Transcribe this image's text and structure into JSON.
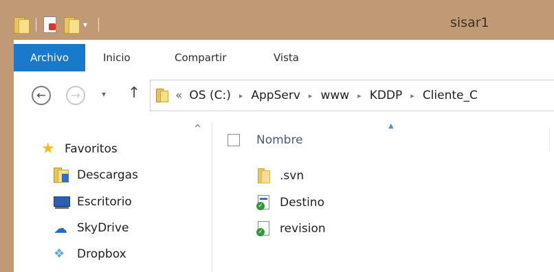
{
  "window": {
    "title": "sisar1"
  },
  "quick_access": {
    "dropdown_glyph": "▾"
  },
  "ribbon": {
    "tabs": [
      {
        "label": "Archivo"
      },
      {
        "label": "Inicio"
      },
      {
        "label": "Compartir"
      },
      {
        "label": "Vista"
      }
    ]
  },
  "address_bar": {
    "back_glyph": "←",
    "forward_glyph": "→",
    "recent_glyph": "▾",
    "up_glyph": "↑",
    "overflow_glyph": "«",
    "crumb_glyph": "▸",
    "path": [
      "OS (C:)",
      "AppServ",
      "www",
      "KDDP",
      "Cliente_C"
    ]
  },
  "navigation_pane": {
    "scroll_up_glyph": "^",
    "favorites_label": "Favoritos",
    "items": [
      {
        "label": "Descargas",
        "icon": "downloads-folder-icon"
      },
      {
        "label": "Escritorio",
        "icon": "desktop-icon"
      },
      {
        "label": "SkyDrive",
        "icon": "skydrive-cloud-icon"
      },
      {
        "label": "Dropbox",
        "icon": "dropbox-icon"
      }
    ]
  },
  "file_list": {
    "sort_glyph": "▲",
    "columns": [
      {
        "label": "Nombre"
      }
    ],
    "files": [
      {
        "name": ".svn",
        "icon": "folder-icon"
      },
      {
        "name": "Destino",
        "icon": "svn-document-icon"
      },
      {
        "name": "revision",
        "icon": "svn-document-icon"
      }
    ]
  },
  "colors": {
    "titlebar": "#bf9a74",
    "file_tab": "#1979ca"
  }
}
